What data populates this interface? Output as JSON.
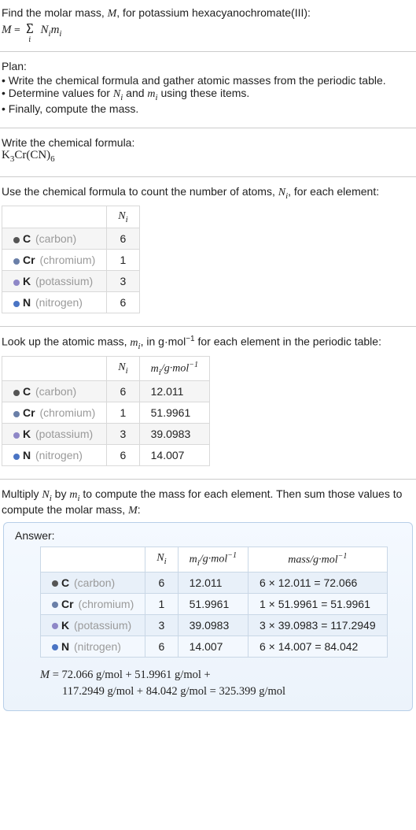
{
  "intro": {
    "line1": "Find the molar mass, M, for potassium hexacyanochromate(III):",
    "formula_html": "M = ∑ N_i m_i"
  },
  "plan": {
    "heading": "Plan:",
    "items": [
      "Write the chemical formula and gather atomic masses from the periodic table.",
      "Determine values for N_i and m_i using these items.",
      "Finally, compute the mass."
    ]
  },
  "chem_formula": {
    "heading": "Write the chemical formula:",
    "formula": "K3Cr(CN)6"
  },
  "count_section": {
    "heading": "Use the chemical formula to count the number of atoms, N_i, for each element:",
    "header_Ni": "N_i",
    "rows": [
      {
        "dot": "#555",
        "sym": "C",
        "name": "(carbon)",
        "n": "6"
      },
      {
        "dot": "#6a7fa8",
        "sym": "Cr",
        "name": "(chromium)",
        "n": "1"
      },
      {
        "dot": "#8e87c7",
        "sym": "K",
        "name": "(potassium)",
        "n": "3"
      },
      {
        "dot": "#4a74c4",
        "sym": "N",
        "name": "(nitrogen)",
        "n": "6"
      }
    ]
  },
  "mass_section": {
    "heading_a": "Look up the atomic mass, m_i, in g·mol",
    "heading_b": " for each element in the periodic table:",
    "header_Ni": "N_i",
    "header_mi": "m_i/g·mol",
    "rows": [
      {
        "dot": "#555",
        "sym": "C",
        "name": "(carbon)",
        "n": "6",
        "m": "12.011"
      },
      {
        "dot": "#6a7fa8",
        "sym": "Cr",
        "name": "(chromium)",
        "n": "1",
        "m": "51.9961"
      },
      {
        "dot": "#8e87c7",
        "sym": "K",
        "name": "(potassium)",
        "n": "3",
        "m": "39.0983"
      },
      {
        "dot": "#4a74c4",
        "sym": "N",
        "name": "(nitrogen)",
        "n": "6",
        "m": "14.007"
      }
    ]
  },
  "multiply_section": {
    "heading": "Multiply N_i by m_i to compute the mass for each element. Then sum those values to compute the molar mass, M:"
  },
  "answer": {
    "label": "Answer:",
    "header_Ni": "N_i",
    "header_mi": "m_i/g·mol",
    "header_mass": "mass/g·mol",
    "rows": [
      {
        "dot": "#555",
        "sym": "C",
        "name": "(carbon)",
        "n": "6",
        "m": "12.011",
        "mass": "6 × 12.011 = 72.066"
      },
      {
        "dot": "#6a7fa8",
        "sym": "Cr",
        "name": "(chromium)",
        "n": "1",
        "m": "51.9961",
        "mass": "1 × 51.9961 = 51.9961"
      },
      {
        "dot": "#8e87c7",
        "sym": "K",
        "name": "(potassium)",
        "n": "3",
        "m": "39.0983",
        "mass": "3 × 39.0983 = 117.2949"
      },
      {
        "dot": "#4a74c4",
        "sym": "N",
        "name": "(nitrogen)",
        "n": "6",
        "m": "14.007",
        "mass": "6 × 14.007 = 84.042"
      }
    ],
    "final_line1": "M = 72.066 g/mol + 51.9961 g/mol +",
    "final_line2": "117.2949 g/mol + 84.042 g/mol = 325.399 g/mol"
  }
}
